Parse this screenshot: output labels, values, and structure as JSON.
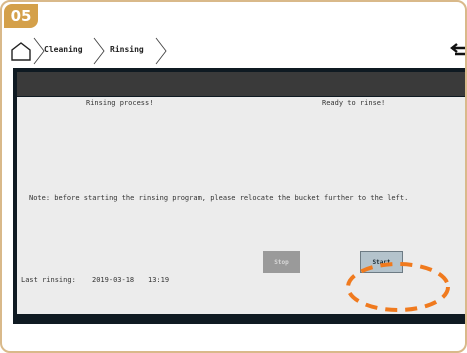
{
  "step": "05",
  "breadcrumb": {
    "items": [
      "Cleaning",
      "Rinsing"
    ]
  },
  "status": {
    "left": "Rinsing process!",
    "right": "Ready to rinse!"
  },
  "note": "Note: before starting the rinsing program, please relocate the bucket further to the left.",
  "last_rinsing": {
    "label": "Last rinsing:",
    "date": "2019-03-18",
    "time": "13:19"
  },
  "buttons": {
    "stop": "Stop",
    "start": "Start"
  },
  "colors": {
    "badge": "#d4a04a",
    "frame_border": "#d9b98a",
    "highlight": "#f07a1e",
    "screen_bg": "#ececec",
    "header_bar": "#3a3a3a"
  }
}
